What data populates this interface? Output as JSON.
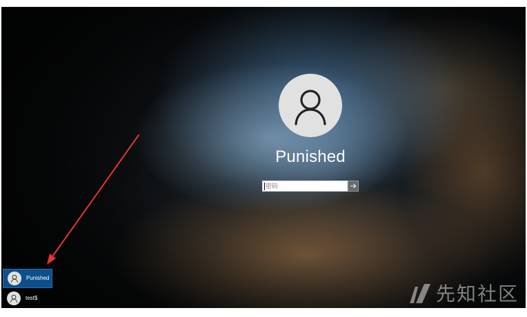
{
  "lock_screen": {
    "user_name": "Punished",
    "password_placeholder": "密码",
    "icons": {
      "avatar": "user-silhouette-icon",
      "submit": "arrow-right-icon"
    }
  },
  "user_switcher": {
    "users": [
      {
        "name": "Punished",
        "selected": true
      },
      {
        "name": "test$",
        "selected": false
      }
    ]
  },
  "annotation": {
    "color": "#e8332f",
    "type": "arrow"
  },
  "watermark": {
    "text": "先知社区",
    "color": "#e1e1e1"
  },
  "colors": {
    "selected_tile": "#0d4f8a",
    "avatar_bg": "#e1e1e1",
    "text": "#ffffff"
  }
}
